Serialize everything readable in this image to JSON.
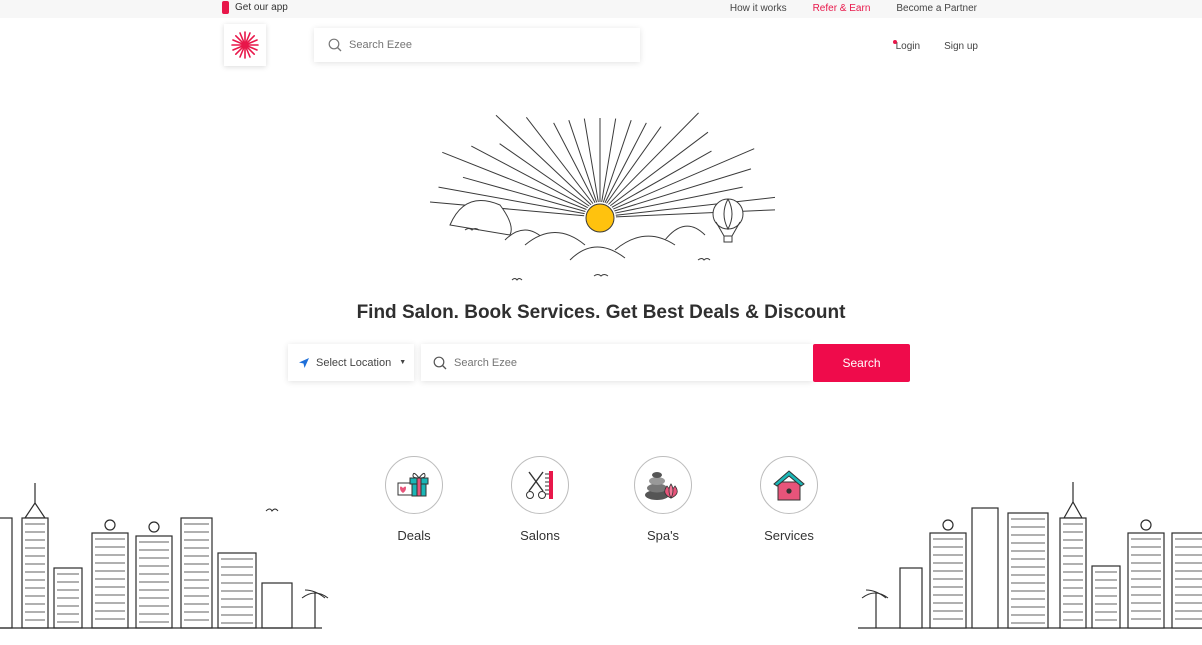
{
  "topbar": {
    "get_app": "Get our app",
    "links": [
      {
        "label": "How it works"
      },
      {
        "label": "Refer & Earn"
      },
      {
        "label": "Become a Partner"
      }
    ]
  },
  "header": {
    "search_placeholder": "Search Ezee",
    "login": "Login",
    "signup": "Sign up"
  },
  "hero": {
    "headline": "Find Salon. Book Services. Get Best Deals & Discount"
  },
  "search": {
    "location_label": "Select Location",
    "placeholder": "Search Ezee",
    "button": "Search"
  },
  "categories": [
    {
      "label": "Deals",
      "icon": "gift-icon"
    },
    {
      "label": "Salons",
      "icon": "scissors-comb-icon"
    },
    {
      "label": "Spa's",
      "icon": "spa-stones-icon"
    },
    {
      "label": "Services",
      "icon": "house-icon"
    }
  ],
  "colors": {
    "accent": "#ef0b4b",
    "sun": "#ffc20e",
    "teal": "#1bb6b6",
    "pink": "#e8547a"
  }
}
